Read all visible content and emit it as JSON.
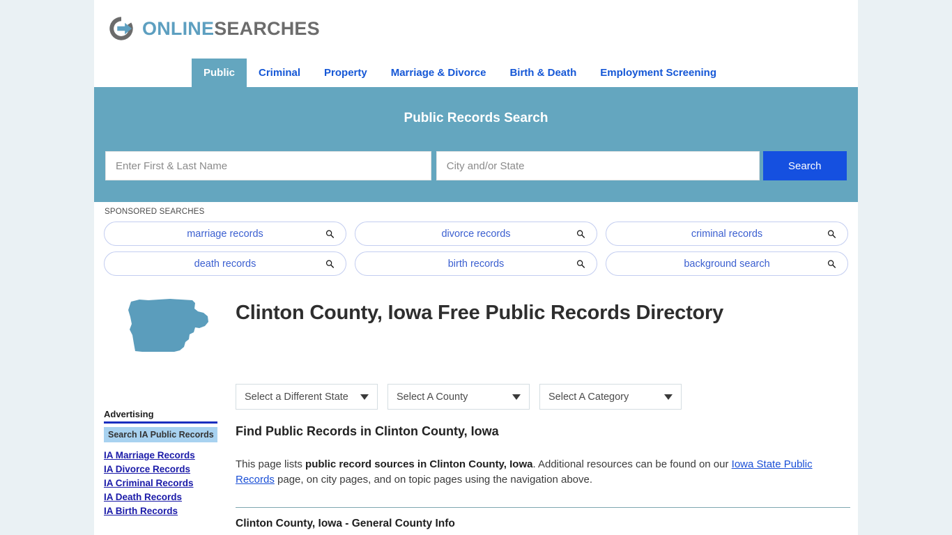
{
  "site": {
    "logo_primary": "ONLINE",
    "logo_secondary": "SEARCHES",
    "logo_icon": "circular-arrow-logo-icon",
    "accent_blue": "#64a6bf",
    "link_blue": "#1557d6",
    "button_blue": "#1550e0"
  },
  "nav": {
    "tabs": [
      {
        "label": "Public",
        "active": true
      },
      {
        "label": "Criminal",
        "active": false
      },
      {
        "label": "Property",
        "active": false
      },
      {
        "label": "Marriage & Divorce",
        "active": false
      },
      {
        "label": "Birth & Death",
        "active": false
      },
      {
        "label": "Employment Screening",
        "active": false
      }
    ]
  },
  "banner": {
    "title": "Public Records Search",
    "name_placeholder": "Enter First & Last Name",
    "name_value": "",
    "location_placeholder": "City and/or State",
    "location_value": "",
    "search_button": "Search"
  },
  "sponsored": {
    "label": "SPONSORED SEARCHES",
    "icon": "search-icon",
    "row1": [
      {
        "label": "marriage records"
      },
      {
        "label": "divorce records"
      },
      {
        "label": "criminal records"
      }
    ],
    "row2": [
      {
        "label": "death records"
      },
      {
        "label": "birth records"
      },
      {
        "label": "background search"
      }
    ]
  },
  "page": {
    "state_icon": "iowa-state-outline-icon",
    "title": "Clinton County, Iowa Free Public Records Directory"
  },
  "selects": {
    "state": "Select a Different State",
    "county": "Select A County",
    "category": "Select A Category"
  },
  "sidebar": {
    "heading": "Advertising",
    "box_label": "Search IA Public Records",
    "links": [
      {
        "label": "IA Marriage Records"
      },
      {
        "label": "IA Divorce Records"
      },
      {
        "label": "IA Criminal Records"
      },
      {
        "label": "IA Death Records"
      },
      {
        "label": "IA Birth Records"
      }
    ]
  },
  "main": {
    "section_title": "Find Public Records in Clinton County, Iowa",
    "paragraph": {
      "part1": "This page lists ",
      "bold1": "public record sources in Clinton County, Iowa",
      "part2": ". Additional resources can be found on our ",
      "link1": "Iowa State Public Records",
      "part3": " page, on city pages, and on topic pages using the navigation above."
    },
    "subsection_title": "Clinton County, Iowa - General County Info"
  }
}
